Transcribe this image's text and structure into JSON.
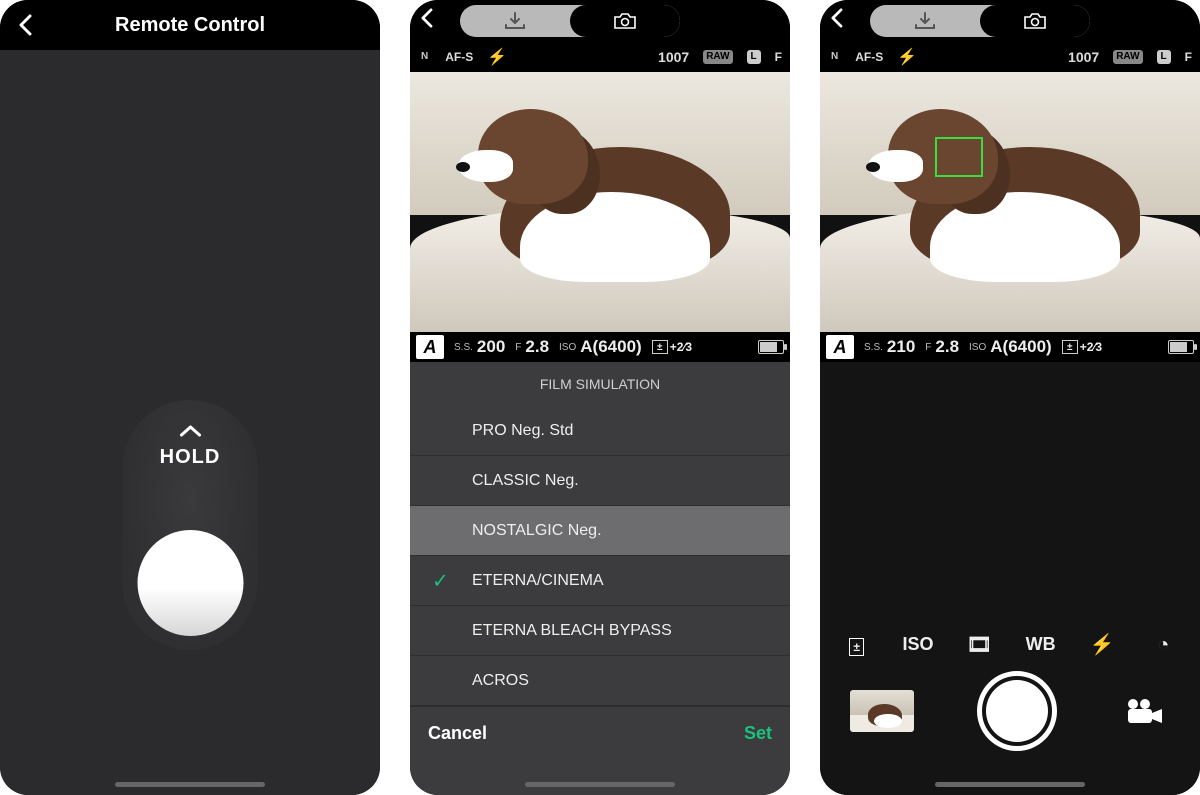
{
  "phone1": {
    "title": "Remote Control",
    "hold_label": "HOLD"
  },
  "shared_top": {
    "af_mode": "AF-S",
    "shots_remaining": "1007",
    "raw_badge": "RAW",
    "size_badge": "L",
    "quality_badge": "F",
    "film_badge": "N"
  },
  "exposure2": {
    "mode": "A",
    "ss_label": "S.S.",
    "ss": "200",
    "f_label": "F",
    "f": "2.8",
    "iso_label": "ISO",
    "iso": "A(6400)",
    "comp": "+2⁄3"
  },
  "exposure3": {
    "mode": "A",
    "ss_label": "S.S.",
    "ss": "210",
    "f_label": "F",
    "f": "2.8",
    "iso_label": "ISO",
    "iso": "A(6400)",
    "comp": "+2⁄3"
  },
  "film_sim": {
    "title": "FILM SIMULATION",
    "items": [
      "PRO Neg. Std",
      "CLASSIC Neg.",
      "NOSTALGIC Neg.",
      "ETERNA/CINEMA",
      "ETERNA BLEACH BYPASS",
      "ACROS"
    ],
    "highlighted_index": 2,
    "checked_index": 3,
    "cancel": "Cancel",
    "set": "Set"
  },
  "controls3": {
    "iso_label": "ISO",
    "wb_label": "WB"
  }
}
